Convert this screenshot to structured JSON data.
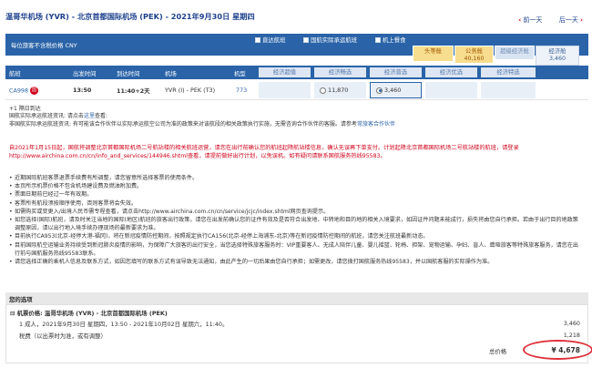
{
  "header": {
    "route_title": "温哥华机场 (YVR) - 北京首都国际机场 (PEK) - 2021年9月30日 星期四",
    "prev_day": "前一天",
    "next_day": "后一天"
  },
  "price_bar": {
    "label": "每位旅客不含税价格 CNY",
    "filters": [
      "直达航班",
      "国航实际承运航班",
      "机上餐食"
    ]
  },
  "fare_classes": [
    {
      "name": "头等舱",
      "price": ""
    },
    {
      "name": "公务舱",
      "price": "40,160"
    },
    {
      "name": "超级经济舱",
      "price": ""
    },
    {
      "name": "经济舱",
      "price": "3,460"
    }
  ],
  "table": {
    "headers": [
      "航班",
      "出发时间",
      "到达时间",
      "机场",
      "机型"
    ],
    "fare_headers": [
      "经济超值",
      "经济畅选",
      "经济普选",
      "经济优选",
      "经济特选"
    ],
    "row": {
      "flight": "CA998",
      "airline_badge": "国",
      "depart": "13:50",
      "arrive": "11:40+2天",
      "airport": "YVR (I) - PEK (T3)",
      "aircraft": "773",
      "fare_options": [
        {
          "price": "11,870",
          "selected": false
        },
        {
          "price": "3,460",
          "selected": true
        }
      ]
    }
  },
  "notes": {
    "stop": "+1 隔日到达",
    "line2_prefix": "国航实际承运航班资讯: 请点击",
    "line2_link": "这里",
    "line2_suffix": "查看:",
    "line3_prefix": "非国航实际承运航班资讯: 有可能该合作伙伴以实际承运航空公司为准的政策来对该航段的相关政策执行实施，无需咨询合作伙伴的客服。请参考",
    "line3_link": "常旅客合作伙伴"
  },
  "notice": "自2021年1月15日起，国航将调整北京首都国际机场二号航站楼的相关航班运营，请您在出行前确认您的航班起降航站楼信息，确认无误再下单支付。计划起降北京首都国际机场二号航站楼的航班，请登录http://www.airchina.com.cn/cn/info_and_services/144946.shtml查看，请提前做好出行计划，以免误机。如有疑问请联系国航服务热线95583。",
  "bullets": [
    "近期国际航班客票退票手续费有所调整，请您留意所选择客票的使用条件。",
    "本页所示机票价格不包含机场建设费及燃油附加费。",
    "票面日期前已经过一年有效期。",
    "客票所有航段须按顺序使用，否则客票将会失效。",
    "如需购买或变更入/出境人民币需专程查看，请点击http://www.airchina.com.cn/cn/service/jcjc/index.shtml网页查询提示。",
    "如您选择(国际)航班，请及时关注当地的国际(地区)航班的旅客出行政策，请您在出发前确认您的证件有效及是否符合出发地、中转地和目的地的相关入境要求，如因证件问题未能成行，损失将由您自行承担。若由于出行目的地政策调整原因，请以出行地入境手续办理现场的最新要求为准。",
    "目前执行CA953(北京-经停大港-福冈)，将在新冠疫情防控期间，按照规定执行CA156(北京-经停上海浦东-北京)等在新冠疫情防控期间的航班，请您关注航班最新动态。",
    "目前国际航空运输业务持续受到新冠肺炎疫情的影响，为保障广大旅客的出行安全，当您选择特殊旅客服务时：VIP重要客人、无成人陪伴儿童、婴儿摇篮、轮椅、担架、宠物运输、孕妇、盲人、聋哑旅客等特殊旅客服务，请您在出行前与国航服务热线95583联系。",
    "请您选择正确的乘机人信息及联系方式，如因您填写的联系方式有误导致无法通知，由此产生的一切后果由您自行承担；如需更改，请您拨打国航服务热线95583，并以国航客服的实际操作为准。"
  ],
  "summary": {
    "title": "您的选项",
    "segment_label": "机票价格: 温哥华机场 (YVR) - 北京首都国际机场 (PEK)",
    "passenger_line": "1 成人，2021年9月30日 星期四，13:50 - 2021年10月02日 星期六，11:40。",
    "fare_amount": "3,460",
    "tax_label": "税费（以出票时为准，或有调整）",
    "tax_amount": "1,218",
    "total_label": "总价格",
    "total_amount": "¥ 4,678"
  },
  "colors": {
    "accent_blue": "#2a63a8",
    "warning_red": "#d0021b",
    "highlight_gold": "#f7dd8e"
  }
}
